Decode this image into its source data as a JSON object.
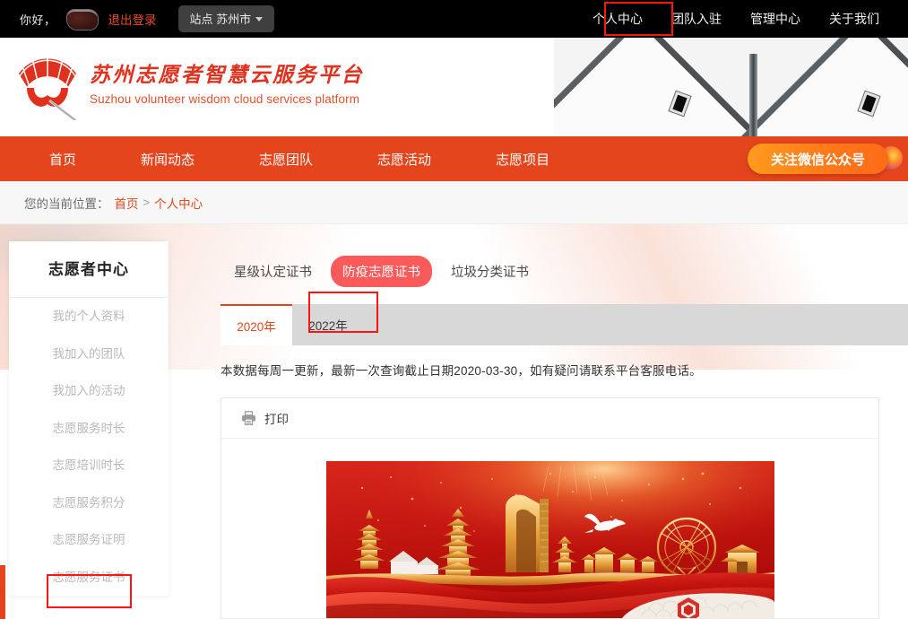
{
  "topbar": {
    "greeting": "你好，",
    "avatar_name": "user-avatar",
    "logout_label": "退出登录",
    "site_label": "站点 苏州市",
    "nav": [
      {
        "label": "个人中心",
        "highlighted": true
      },
      {
        "label": "团队入驻",
        "highlighted": false
      },
      {
        "label": "管理中心",
        "highlighted": false
      },
      {
        "label": "关于我们",
        "highlighted": false
      }
    ]
  },
  "header": {
    "brand_cn": "苏州志愿者智慧云服务平台",
    "brand_en": "Suzhou volunteer wisdom cloud services platform",
    "logo_name": "suzhou-fan-logo"
  },
  "mainnav": {
    "items": [
      {
        "label": "首页"
      },
      {
        "label": "新闻动态"
      },
      {
        "label": "志愿团队"
      },
      {
        "label": "志愿活动"
      },
      {
        "label": "志愿项目"
      }
    ],
    "wechat_button": "关注微信公众号"
  },
  "breadcrumb": {
    "label": "您的当前位置：",
    "home": "首页",
    "separator": ">",
    "current": "个人中心"
  },
  "sidebar": {
    "title": "志愿者中心",
    "items": [
      {
        "label": "我的个人资料"
      },
      {
        "label": "我加入的团队"
      },
      {
        "label": "我加入的活动"
      },
      {
        "label": "志愿服务时长"
      },
      {
        "label": "志愿培训时长"
      },
      {
        "label": "志愿服务积分"
      },
      {
        "label": "志愿服务证明"
      },
      {
        "label": "志愿服务证书"
      }
    ],
    "highlighted_item": "志愿服务证书"
  },
  "main": {
    "cert_tabs": [
      {
        "label": "星级认定证书",
        "active": false
      },
      {
        "label": "防疫志愿证书",
        "active": true
      },
      {
        "label": "垃圾分类证书",
        "active": false
      }
    ],
    "year_tabs": [
      {
        "label": "2020年",
        "active": true
      },
      {
        "label": "2022年",
        "active": false
      }
    ],
    "highlighted_year": "2022年",
    "notice": "本数据每周一更新，最新一次查询截止日期2020-03-30，如有疑问请联系平台客服电话。",
    "print_label": "打印",
    "print_icon": "printer-icon",
    "certificate_alt": "防疫志愿证书图片"
  },
  "colors": {
    "brand_red": "#e4451c",
    "accent_red": "#fb5a5a",
    "topbar_black": "#000000",
    "highlight_box": "#ff1414",
    "logout_red": "#e8492a",
    "tabbar_gray": "#d8d8d8"
  }
}
